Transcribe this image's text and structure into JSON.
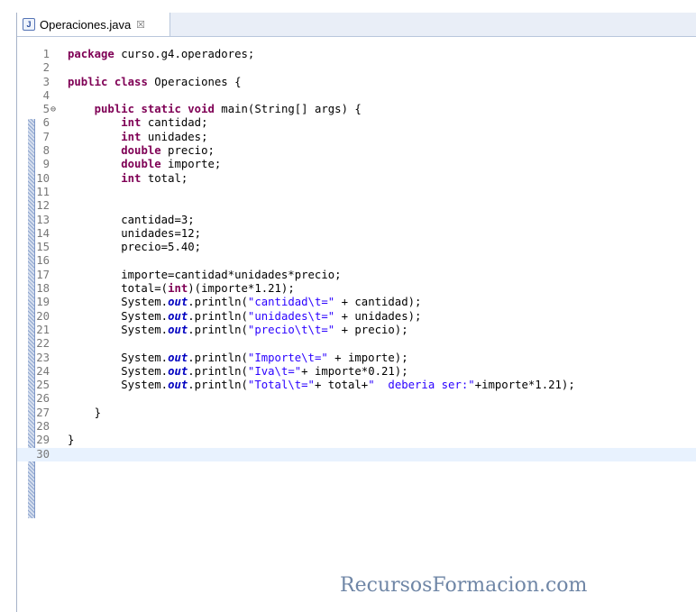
{
  "tab": {
    "title": "Operaciones.java",
    "icon": "J",
    "close": "☒"
  },
  "code": {
    "current_line": 30,
    "lines": [
      {
        "n": "1",
        "fold": "",
        "tokens": [
          {
            "t": "package",
            "c": "kw"
          },
          {
            "t": " curso.g4.operadores;",
            "c": ""
          }
        ]
      },
      {
        "n": "2",
        "fold": "",
        "tokens": []
      },
      {
        "n": "3",
        "fold": "",
        "tokens": [
          {
            "t": "public",
            "c": "kw"
          },
          {
            "t": " ",
            "c": ""
          },
          {
            "t": "class",
            "c": "kw"
          },
          {
            "t": " Operaciones {",
            "c": ""
          }
        ]
      },
      {
        "n": "4",
        "fold": "",
        "tokens": []
      },
      {
        "n": "5",
        "fold": "⊖",
        "tokens": [
          {
            "t": "    ",
            "c": ""
          },
          {
            "t": "public",
            "c": "kw"
          },
          {
            "t": " ",
            "c": ""
          },
          {
            "t": "static",
            "c": "kw"
          },
          {
            "t": " ",
            "c": ""
          },
          {
            "t": "void",
            "c": "kw"
          },
          {
            "t": " main(String[] args) {",
            "c": ""
          }
        ]
      },
      {
        "n": "6",
        "fold": "",
        "tokens": [
          {
            "t": "        ",
            "c": ""
          },
          {
            "t": "int",
            "c": "kw"
          },
          {
            "t": " cantidad;",
            "c": ""
          }
        ]
      },
      {
        "n": "7",
        "fold": "",
        "tokens": [
          {
            "t": "        ",
            "c": ""
          },
          {
            "t": "int",
            "c": "kw"
          },
          {
            "t": " unidades;",
            "c": ""
          }
        ]
      },
      {
        "n": "8",
        "fold": "",
        "tokens": [
          {
            "t": "        ",
            "c": ""
          },
          {
            "t": "double",
            "c": "kw"
          },
          {
            "t": " precio;",
            "c": ""
          }
        ]
      },
      {
        "n": "9",
        "fold": "",
        "tokens": [
          {
            "t": "        ",
            "c": ""
          },
          {
            "t": "double",
            "c": "kw"
          },
          {
            "t": " importe;",
            "c": ""
          }
        ]
      },
      {
        "n": "10",
        "fold": "",
        "tokens": [
          {
            "t": "        ",
            "c": ""
          },
          {
            "t": "int",
            "c": "kw"
          },
          {
            "t": " total;",
            "c": ""
          }
        ]
      },
      {
        "n": "11",
        "fold": "",
        "tokens": []
      },
      {
        "n": "12",
        "fold": "",
        "tokens": []
      },
      {
        "n": "13",
        "fold": "",
        "tokens": [
          {
            "t": "        cantidad=3;",
            "c": ""
          }
        ]
      },
      {
        "n": "14",
        "fold": "",
        "tokens": [
          {
            "t": "        unidades=12;",
            "c": ""
          }
        ]
      },
      {
        "n": "15",
        "fold": "",
        "tokens": [
          {
            "t": "        precio=5.40;",
            "c": ""
          }
        ]
      },
      {
        "n": "16",
        "fold": "",
        "tokens": []
      },
      {
        "n": "17",
        "fold": "",
        "tokens": [
          {
            "t": "        importe=cantidad*unidades*precio;",
            "c": ""
          }
        ]
      },
      {
        "n": "18",
        "fold": "",
        "tokens": [
          {
            "t": "        total=(",
            "c": ""
          },
          {
            "t": "int",
            "c": "kw"
          },
          {
            "t": ")(importe*1.21);",
            "c": ""
          }
        ]
      },
      {
        "n": "19",
        "fold": "",
        "tokens": [
          {
            "t": "        System.",
            "c": ""
          },
          {
            "t": "out",
            "c": "fld"
          },
          {
            "t": ".println(",
            "c": ""
          },
          {
            "t": "\"cantidad\\t=\"",
            "c": "str"
          },
          {
            "t": " + cantidad);",
            "c": ""
          }
        ]
      },
      {
        "n": "20",
        "fold": "",
        "tokens": [
          {
            "t": "        System.",
            "c": ""
          },
          {
            "t": "out",
            "c": "fld"
          },
          {
            "t": ".println(",
            "c": ""
          },
          {
            "t": "\"unidades\\t=\"",
            "c": "str"
          },
          {
            "t": " + unidades);",
            "c": ""
          }
        ]
      },
      {
        "n": "21",
        "fold": "",
        "tokens": [
          {
            "t": "        System.",
            "c": ""
          },
          {
            "t": "out",
            "c": "fld"
          },
          {
            "t": ".println(",
            "c": ""
          },
          {
            "t": "\"precio\\t\\t=\"",
            "c": "str"
          },
          {
            "t": " + precio);",
            "c": ""
          }
        ]
      },
      {
        "n": "22",
        "fold": "",
        "tokens": []
      },
      {
        "n": "23",
        "fold": "",
        "tokens": [
          {
            "t": "        System.",
            "c": ""
          },
          {
            "t": "out",
            "c": "fld"
          },
          {
            "t": ".println(",
            "c": ""
          },
          {
            "t": "\"Importe\\t=\"",
            "c": "str"
          },
          {
            "t": " + importe);",
            "c": ""
          }
        ]
      },
      {
        "n": "24",
        "fold": "",
        "tokens": [
          {
            "t": "        System.",
            "c": ""
          },
          {
            "t": "out",
            "c": "fld"
          },
          {
            "t": ".println(",
            "c": ""
          },
          {
            "t": "\"Iva\\t=\"",
            "c": "str"
          },
          {
            "t": "+ importe*0.21);",
            "c": ""
          }
        ]
      },
      {
        "n": "25",
        "fold": "",
        "tokens": [
          {
            "t": "        System.",
            "c": ""
          },
          {
            "t": "out",
            "c": "fld"
          },
          {
            "t": ".println(",
            "c": ""
          },
          {
            "t": "\"Total\\t=\"",
            "c": "str"
          },
          {
            "t": "+ total+",
            "c": ""
          },
          {
            "t": "\"  deberia ser:\"",
            "c": "str"
          },
          {
            "t": "+importe*1.21);",
            "c": ""
          }
        ]
      },
      {
        "n": "26",
        "fold": "",
        "tokens": []
      },
      {
        "n": "27",
        "fold": "",
        "tokens": [
          {
            "t": "    }",
            "c": ""
          }
        ]
      },
      {
        "n": "28",
        "fold": "",
        "tokens": []
      },
      {
        "n": "29",
        "fold": "",
        "tokens": [
          {
            "t": "}",
            "c": ""
          }
        ]
      },
      {
        "n": "30",
        "fold": "",
        "tokens": []
      }
    ]
  },
  "watermark": "RecursosFormacion.com"
}
